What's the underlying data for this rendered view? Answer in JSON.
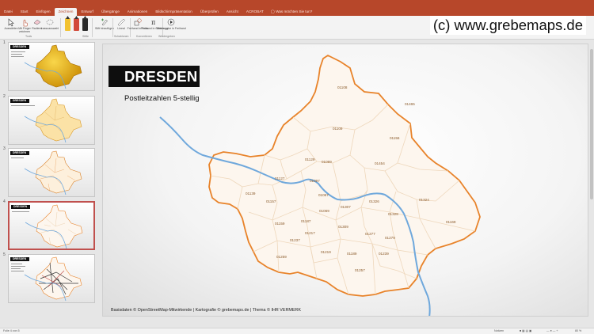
{
  "ribbon": {
    "tabs": [
      "Datei",
      "Start",
      "Einfügen",
      "Zeichnen",
      "Entwurf",
      "Übergänge",
      "Animationen",
      "Bildschirmpräsentation",
      "Überprüfen",
      "Ansicht",
      "ACROBAT"
    ],
    "active_tab": "Zeichnen",
    "tellme": "Was möchten Sie tun?",
    "buttons": {
      "select": "Auswählen",
      "finger": "Mit Finger zeichnen",
      "eraser": "Radierer",
      "lasso": "Lassoauswahl",
      "ink": "Stift hinzufügen",
      "ruler": "Lineal",
      "freeform": "Freihand in Form",
      "math": "Freihand in Gleichung",
      "replay": "Wiedergabe in Freihand"
    },
    "groups": {
      "tools": "Tools",
      "pens": "Stifte",
      "stencils": "Schablonen",
      "convert": "Konvertieren",
      "replay": "Wiedergeben"
    }
  },
  "watermark": "(c) www.grebemaps.de",
  "thumbnails": [
    {
      "number": "1",
      "title": "DRESDEN"
    },
    {
      "number": "2",
      "title": "DRESDEN"
    },
    {
      "number": "3",
      "title": "DRESDEN"
    },
    {
      "number": "4",
      "title": "DRESDEN"
    },
    {
      "number": "5",
      "title": "DRESDEN"
    }
  ],
  "slide": {
    "title": "DRESDEN",
    "subtitle": "Postleitzahlen 5-stellig",
    "credits": "Basisdaten © OpenStreetMap-Mitwirkende | Kartografie © grebemaps.de | Thema © IHR VERMERK",
    "postcodes": [
      "01108",
      "01465",
      "01109",
      "01156",
      "01129",
      "01099",
      "01454",
      "01139",
      "01127",
      "01097",
      "01067",
      "01324",
      "01157",
      "01069",
      "01307",
      "01328",
      "01169",
      "01159",
      "01187",
      "01309",
      "01326",
      "01217",
      "01277",
      "01279",
      "01259",
      "01219",
      "01239",
      "01257",
      "01189",
      "01237"
    ]
  },
  "statusbar": {
    "slide_info": "Folie 4 von 5",
    "notes": "Notizen",
    "zoom": "80 %"
  },
  "colors": {
    "brand": "#b7472a",
    "boundary": "#e8832a",
    "map_fill": "#fdf6ee",
    "river": "#6fa8dc"
  }
}
